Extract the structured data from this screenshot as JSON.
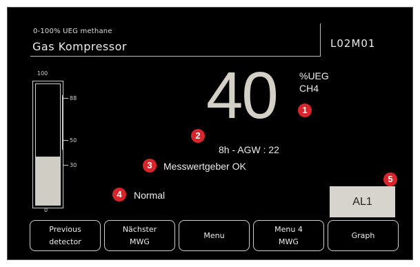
{
  "header": {
    "subtitle": "0-100% UEG methane",
    "title": "Gas Kompressor",
    "detector_id": "L02M01"
  },
  "scale": {
    "max_label": "100",
    "min_label": "0",
    "ticks": [
      "88",
      "50",
      "30"
    ],
    "fill_percent": 40
  },
  "reading": {
    "value": "40",
    "unit": "%UEG",
    "gas": "CH4",
    "agw": "8h - AGW : 22"
  },
  "status": {
    "sensor": "Messwertgeber OK",
    "mode": "Normal"
  },
  "alarm": {
    "label": "AL1"
  },
  "callouts": [
    "1",
    "2",
    "3",
    "4",
    "5"
  ],
  "softkeys": [
    "Previous\ndetector",
    "Nächster\nMWG",
    "Menu",
    "Menu 4\nMWG",
    "Graph"
  ],
  "colors": {
    "screen_bg": "#000000",
    "callout_red": "#d7262b",
    "gauge_fill": "#cfcdc4"
  }
}
